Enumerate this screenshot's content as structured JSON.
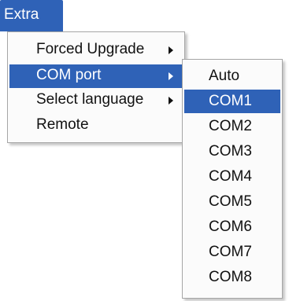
{
  "menubar": {
    "extra_label": "Extra"
  },
  "menu": {
    "items": [
      {
        "label": "Forced Upgrade",
        "has_submenu": true
      },
      {
        "label": "COM port",
        "has_submenu": true,
        "selected": true
      },
      {
        "label": "Select language",
        "has_submenu": true
      },
      {
        "label": "Remote",
        "has_submenu": false
      }
    ]
  },
  "submenu": {
    "items": [
      {
        "label": "Auto"
      },
      {
        "label": "COM1",
        "selected": true
      },
      {
        "label": "COM2"
      },
      {
        "label": "COM3"
      },
      {
        "label": "COM4"
      },
      {
        "label": "COM5"
      },
      {
        "label": "COM6"
      },
      {
        "label": "COM7"
      },
      {
        "label": "COM8"
      }
    ]
  },
  "colors": {
    "highlight": "#2f62b7",
    "menu_background": "#fbfbfb",
    "border": "#a6a6a6"
  },
  "icons": {
    "submenu_arrow": "chevron-right-icon"
  }
}
